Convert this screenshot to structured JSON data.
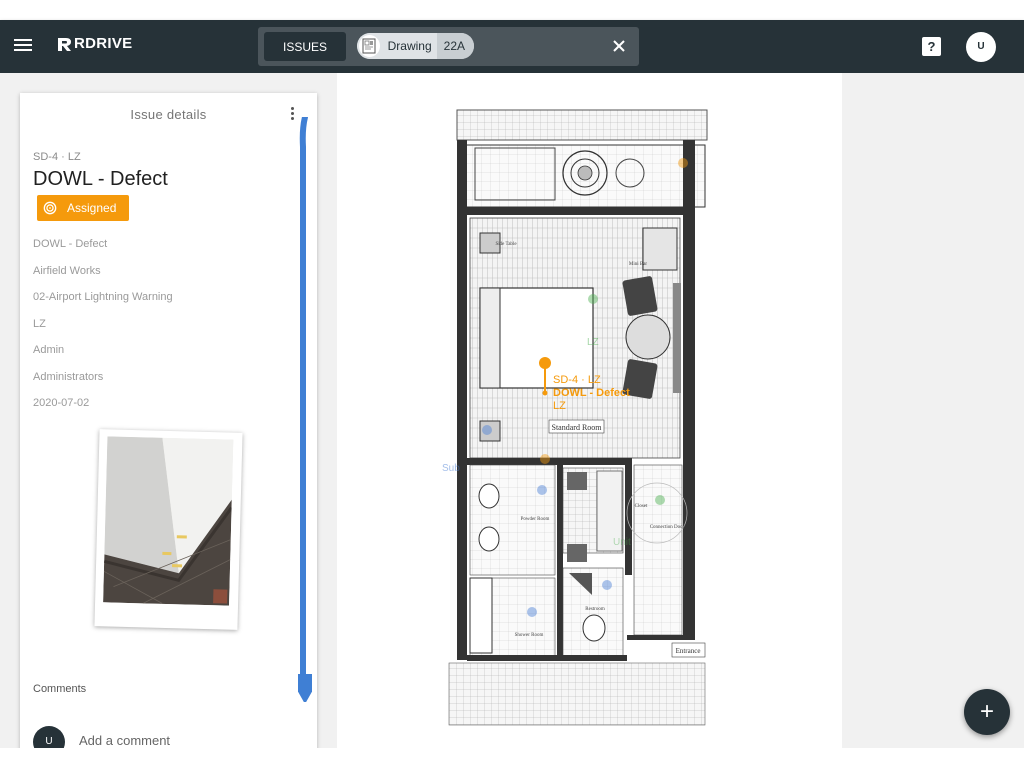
{
  "app": {
    "brand": "RDRIVE"
  },
  "header": {
    "issues_button": "ISSUES",
    "filter_chip": {
      "label": "Drawing",
      "count": "22A"
    },
    "avatar_initial": "U"
  },
  "issue_panel": {
    "title": "Issue details",
    "code": "SD-4 · LZ",
    "name": "DOWL - Defect",
    "status": "Assigned",
    "fields": [
      "DOWL - Defect",
      "Airfield Works",
      "02-Airport Lightning Warning",
      "LZ",
      "Admin",
      "Administrators",
      "2020-07-02"
    ],
    "comments_label": "Comments",
    "comment_avatar": "U",
    "comment_placeholder": "Add a comment"
  },
  "drawing": {
    "pin_code": "SD-4 · LZ",
    "pin_title": "DOWL - Defect",
    "pin_zone": "LZ",
    "room_labels": [
      "Standard Room",
      "Entrance",
      "Powder Room",
      "Shower Room",
      "Closet",
      "Connection Door",
      "Mini Bar",
      "Side Table",
      "Restroom"
    ],
    "faded_labels": [
      "LZ",
      "Sub",
      "Unit"
    ]
  },
  "colors": {
    "appbar": "#263238",
    "status": "#f59a0c",
    "scroll": "#3f7fd4",
    "pin": "#f59a0c"
  },
  "fab": {
    "icon": "plus-icon"
  }
}
